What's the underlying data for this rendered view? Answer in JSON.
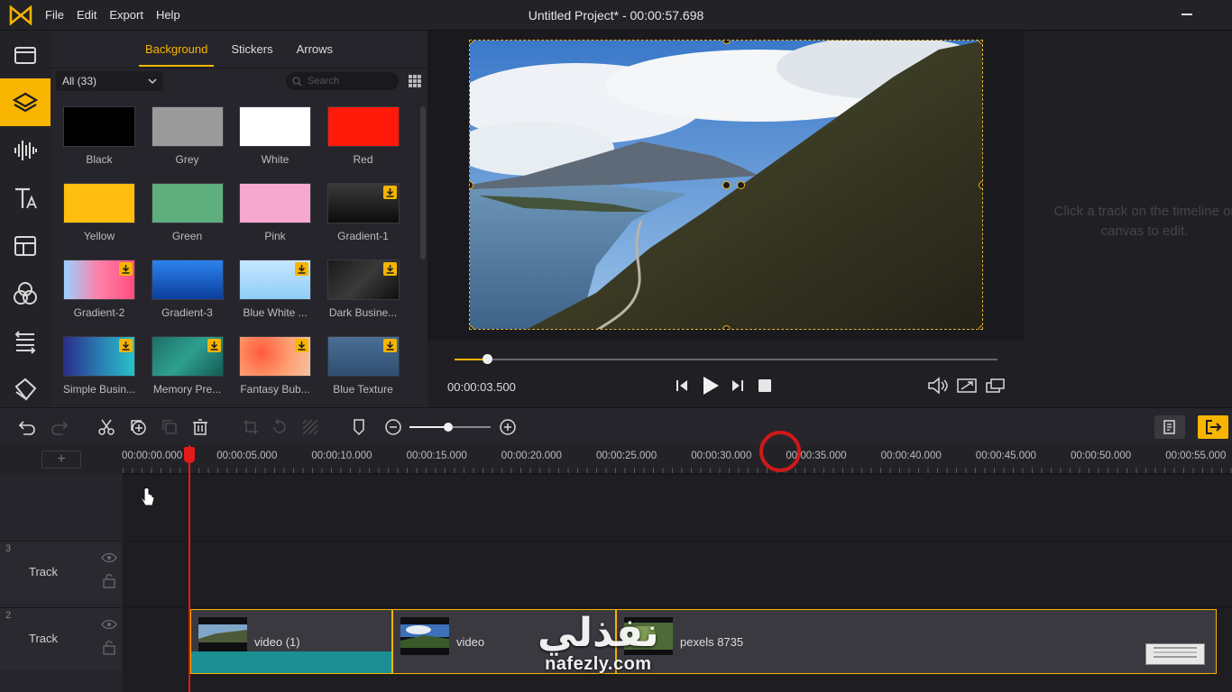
{
  "app": {
    "title": "Untitled Project* - 00:00:57.698",
    "menu": [
      "File",
      "Edit",
      "Export",
      "Help"
    ]
  },
  "sidebar": {
    "items": [
      {
        "icon": "folder-icon"
      },
      {
        "icon": "layers-icon",
        "active": true
      },
      {
        "icon": "audio-wave-icon"
      },
      {
        "icon": "text-icon"
      },
      {
        "icon": "template-icon"
      },
      {
        "icon": "filters-icon"
      },
      {
        "icon": "transitions-icon"
      },
      {
        "icon": "overlay-icon"
      }
    ]
  },
  "library": {
    "tabs": [
      "Background",
      "Stickers",
      "Arrows"
    ],
    "active_tab": "Background",
    "filter_value": "All (33)",
    "search_placeholder": "Search",
    "tiles": [
      {
        "label": "Black",
        "color": "#000000",
        "download": false
      },
      {
        "label": "Grey",
        "color": "#9b9b9b",
        "download": false
      },
      {
        "label": "White",
        "color": "#ffffff",
        "download": false
      },
      {
        "label": "Red",
        "color": "#ff1a0a",
        "download": false
      },
      {
        "label": "Yellow",
        "color": "#ffbe0f",
        "download": false
      },
      {
        "label": "Green",
        "color": "#5fae7e",
        "download": false
      },
      {
        "label": "Pink",
        "color": "#f7a8cf",
        "download": false
      },
      {
        "label": "Gradient-1",
        "color": "linear-gradient(180deg,#3a3a3a,#0c0c0c)",
        "download": true
      },
      {
        "label": "Gradient-2",
        "color": "linear-gradient(90deg,#9ad0ff,#ff7fa8,#ff4e7f)",
        "download": true
      },
      {
        "label": "Gradient-3",
        "color": "linear-gradient(180deg,#2d83f0,#0b3e9c)",
        "download": false
      },
      {
        "label": "Blue White ...",
        "color": "linear-gradient(180deg,#c7e7ff,#8fcdf7)",
        "download": true
      },
      {
        "label": "Dark Busine...",
        "color": "linear-gradient(135deg,#1a1a1a,#3a3a3a,#0f0f0f)",
        "download": true
      },
      {
        "label": "Simple Busin...",
        "color": "linear-gradient(90deg,#2a2e8c,#2a7bb0,#27c3c9)",
        "download": true
      },
      {
        "label": "Memory Pre...",
        "color": "linear-gradient(135deg,#1d6f66,#2e9f8f,#135a53)",
        "download": true
      },
      {
        "label": "Fantasy Bub...",
        "color": "radial-gradient(circle at 30% 40%,#ff5a3a,#ff9a6e,#f3c4a4)",
        "download": true
      },
      {
        "label": "Blue Texture",
        "color": "linear-gradient(180deg,#4a6e94,#2f4f72)",
        "download": true
      }
    ]
  },
  "player": {
    "timecode": "00:00:03.500",
    "progress": 0.06
  },
  "properties": {
    "hint": "Click a track on the timeline or canvas to edit."
  },
  "toolbar": {
    "zoom_level": 0.48
  },
  "timeline": {
    "add_track_label": "+",
    "ruler": [
      "00:00:00.000",
      "00:00:05.000",
      "00:00:10.000",
      "00:00:15.000",
      "00:00:20.000",
      "00:00:25.000",
      "00:00:30.000",
      "00:00:35.000",
      "00:00:40.000",
      "00:00:45.000",
      "00:00:50.000",
      "00:00:55.000"
    ],
    "tracks": [
      {
        "number": "3",
        "name": "Track"
      },
      {
        "number": "2",
        "name": "Track"
      }
    ],
    "clips": [
      {
        "label": "video (1)"
      },
      {
        "label": "video"
      },
      {
        "label": "pexels 8735"
      }
    ]
  },
  "watermark": {
    "arabic": "نفذلي",
    "url": "nafezly.com"
  }
}
